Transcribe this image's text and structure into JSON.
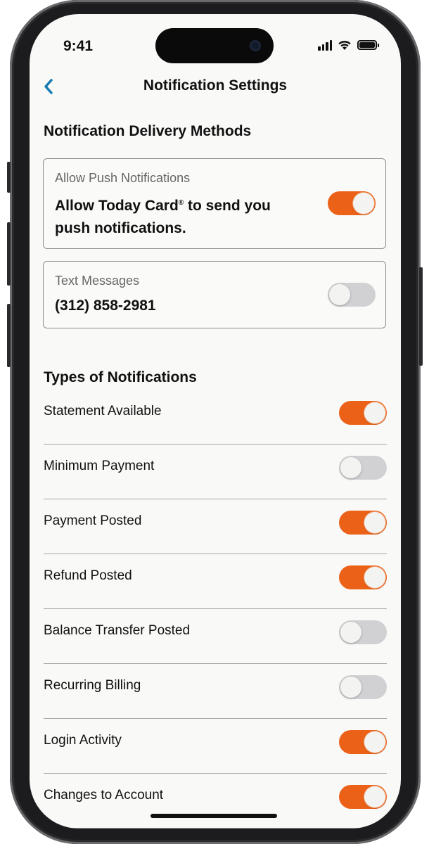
{
  "status_bar": {
    "time": "9:41"
  },
  "header": {
    "title": "Notification Settings"
  },
  "delivery": {
    "title": "Notification Delivery Methods",
    "push": {
      "label": "Allow Push Notifications",
      "text_line1_prefix": "Allow Today Card",
      "text_line1_sup": "®",
      "text_line1_suffix": " to send you",
      "text_line2": "push notifications.",
      "enabled": true
    },
    "sms": {
      "label": "Text Messages",
      "phone": "(312) 858-2981",
      "enabled": false
    }
  },
  "types": {
    "title": "Types of Notifications",
    "items": [
      {
        "label": "Statement Available",
        "enabled": true
      },
      {
        "label": "Minimum Payment",
        "enabled": false
      },
      {
        "label": "Payment Posted",
        "enabled": true
      },
      {
        "label": "Refund Posted",
        "enabled": true
      },
      {
        "label": "Balance Transfer Posted",
        "enabled": false
      },
      {
        "label": "Recurring Billing",
        "enabled": false
      },
      {
        "label": "Login Activity",
        "enabled": true
      },
      {
        "label": "Changes to Account",
        "enabled": true
      }
    ]
  },
  "colors": {
    "toggle_on": "#ec6118",
    "toggle_off": "#d1d1d3",
    "back_accent": "#1a7bb0"
  },
  "icons": {
    "back": "chevron-left-icon",
    "signal": "cellular-signal-icon",
    "wifi": "wifi-icon",
    "battery": "battery-icon"
  }
}
